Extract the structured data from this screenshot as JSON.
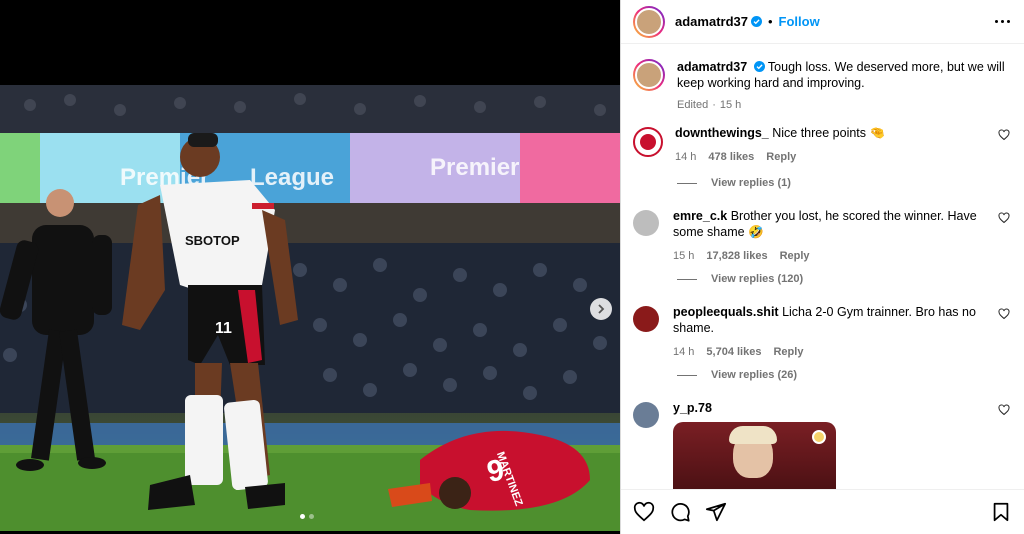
{
  "post": {
    "author": "adamatrd37",
    "follow_label": "Follow",
    "separator": "•",
    "caption": "Tough loss. We deserved more, but we will keep working hard and improving.",
    "edited": "Edited",
    "edited_time": "15 h"
  },
  "photo": {
    "jersey_number_player": "11",
    "jersey_number_opponent": "9",
    "opponent_name": "MARTINEZ",
    "sponsor": "SBOTOP",
    "board_text_1": "Premier",
    "board_text_2": "League"
  },
  "comments": [
    {
      "user": "downthewings_",
      "text": "Nice three points 🤏",
      "time": "14 h",
      "likes": "478 likes",
      "reply": "Reply",
      "view_replies": "View replies (1)"
    },
    {
      "user": "emre_c.k",
      "text": "Brother you lost, he scored the winner. Have some shame 🤣",
      "time": "15 h",
      "likes": "17,828 likes",
      "reply": "Reply",
      "view_replies": "View replies (120)"
    },
    {
      "user": "peopleequals.shit",
      "text": "Licha 2-0 Gym trainner. Bro has no shame.",
      "time": "14 h",
      "likes": "5,704 likes",
      "reply": "Reply",
      "view_replies": "View replies (26)"
    },
    {
      "user": "y_p.78",
      "text": ""
    }
  ],
  "icons": {
    "like": "heart-icon",
    "comment": "comment-icon",
    "share": "send-icon",
    "save": "bookmark-icon",
    "more": "more-horizontal-icon",
    "next": "chevron-right-icon"
  },
  "colors": {
    "accent": "#0095f6",
    "muted": "#737373",
    "fulham_white": "#ffffff",
    "united_red": "#c8102e"
  }
}
